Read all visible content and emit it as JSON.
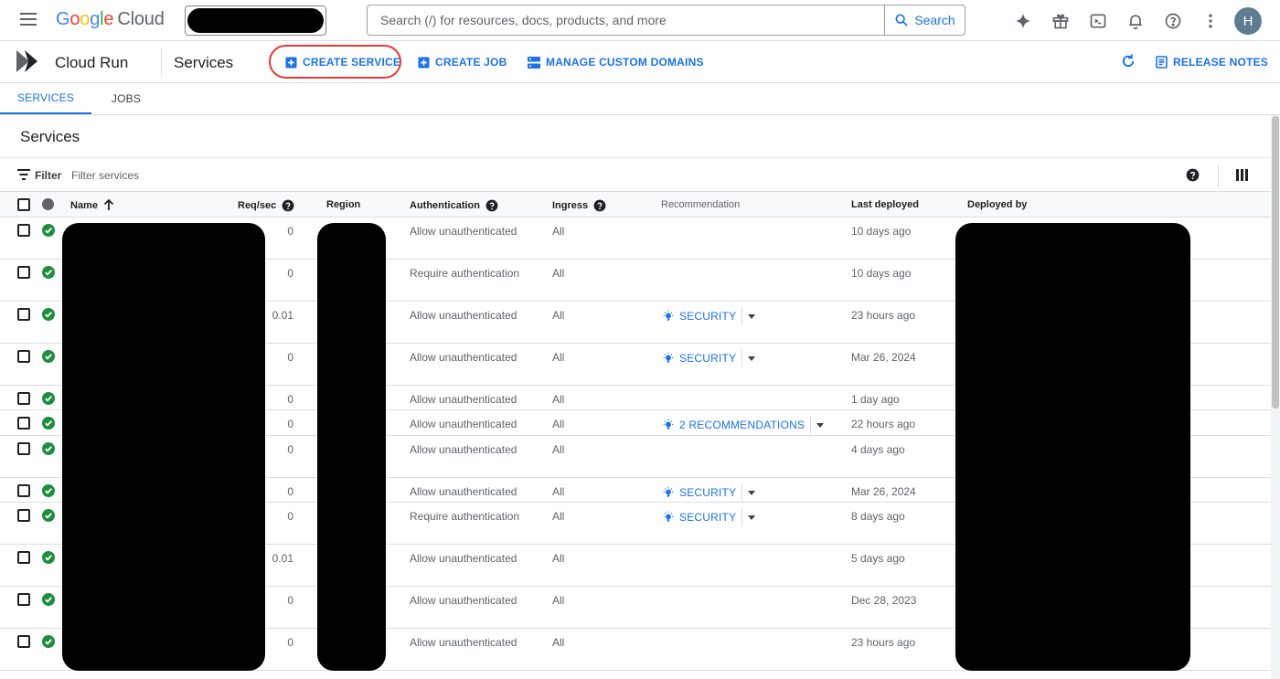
{
  "topbar": {
    "search_placeholder": "Search (/) for resources, docs, products, and more",
    "search_button": "Search",
    "avatar_initial": "H",
    "logo": {
      "g": "G",
      "o1": "o",
      "o2": "o",
      "g2": "g",
      "l": "l",
      "e": "e",
      "cloud": "Cloud"
    }
  },
  "product": {
    "name": "Cloud Run",
    "page_title": "Services",
    "actions": {
      "create_service": "CREATE SERVICE",
      "create_job": "CREATE JOB",
      "manage_domains": "MANAGE CUSTOM DOMAINS",
      "release_notes": "RELEASE NOTES"
    }
  },
  "tabs": [
    {
      "label": "SERVICES",
      "active": true
    },
    {
      "label": "JOBS",
      "active": false
    }
  ],
  "section": {
    "title": "Services",
    "filter_label": "Filter",
    "filter_placeholder": "Filter services"
  },
  "table": {
    "columns": {
      "name": "Name",
      "req": "Req/sec",
      "region": "Region",
      "auth": "Authentication",
      "ingress": "Ingress",
      "recommendation": "Recommendation",
      "last_deployed": "Last deployed",
      "deployed_by": "Deployed by"
    },
    "rows": [
      {
        "req": "0",
        "auth": "Allow unauthenticated",
        "ingress": "All",
        "rec": "",
        "deployed": "10 days ago"
      },
      {
        "req": "0",
        "auth": "Require authentication",
        "ingress": "All",
        "rec": "",
        "deployed": "10 days ago"
      },
      {
        "req": "0.01",
        "auth": "Allow unauthenticated",
        "ingress": "All",
        "rec": "SECURITY",
        "deployed": "23 hours ago"
      },
      {
        "req": "0",
        "auth": "Allow unauthenticated",
        "ingress": "All",
        "rec": "SECURITY",
        "deployed": "Mar 26, 2024"
      },
      {
        "req": "0",
        "auth": "Allow unauthenticated",
        "ingress": "All",
        "rec": "",
        "deployed": "1 day ago"
      },
      {
        "req": "0",
        "auth": "Allow unauthenticated",
        "ingress": "All",
        "rec": "2 RECOMMENDATIONS",
        "deployed": "22 hours ago"
      },
      {
        "req": "0",
        "auth": "Allow unauthenticated",
        "ingress": "All",
        "rec": "",
        "deployed": "4 days ago"
      },
      {
        "req": "0",
        "auth": "Allow unauthenticated",
        "ingress": "All",
        "rec": "SECURITY",
        "deployed": "Mar 26, 2024"
      },
      {
        "req": "0",
        "auth": "Require authentication",
        "ingress": "All",
        "rec": "SECURITY",
        "deployed": "8 days ago"
      },
      {
        "req": "0.01",
        "auth": "Allow unauthenticated",
        "ingress": "All",
        "rec": "",
        "deployed": "5 days ago"
      },
      {
        "req": "0",
        "auth": "Allow unauthenticated",
        "ingress": "All",
        "rec": "",
        "deployed": "Dec 28, 2023"
      },
      {
        "req": "0",
        "auth": "Allow unauthenticated",
        "ingress": "All",
        "rec": "",
        "deployed": "23 hours ago"
      }
    ]
  },
  "colors": {
    "accent": "#1a73e8",
    "success": "#1e8e3e",
    "highlight_outline": "#e53935"
  },
  "icons": [
    "menu-icon",
    "search-icon",
    "gemini-icon",
    "gift-icon",
    "cloud-shell-icon",
    "bell-icon",
    "help-icon",
    "more-vert-icon",
    "cloud-run-logo-icon",
    "add-box-icon",
    "domains-icon",
    "refresh-icon",
    "release-notes-icon",
    "filter-icon",
    "columns-icon",
    "sort-up-icon",
    "check-circle-icon",
    "lightbulb-icon",
    "caret-down-icon"
  ]
}
